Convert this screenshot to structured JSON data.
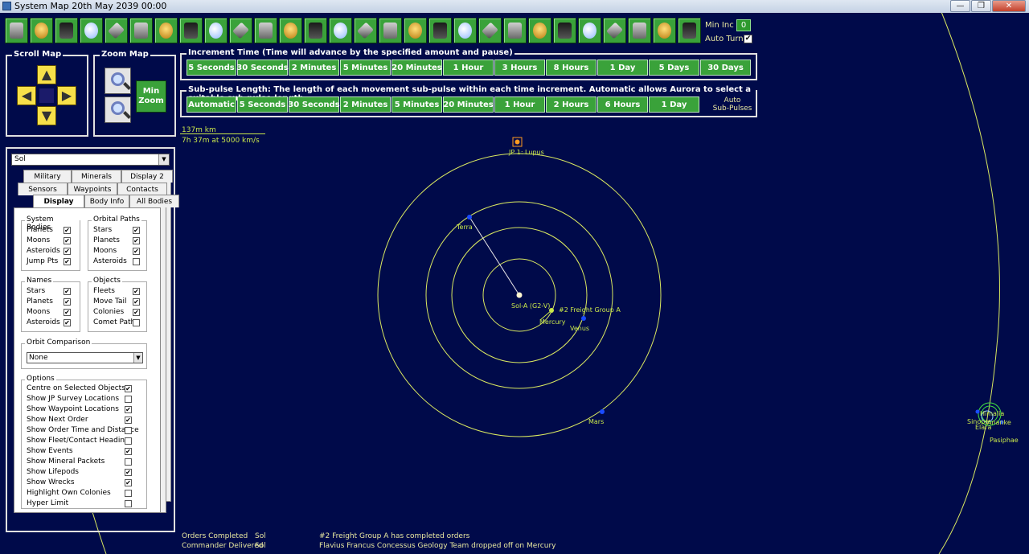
{
  "window": {
    "title": "System Map   20th May 2039 00:00"
  },
  "toolbar": {
    "buttons": [
      "economics-icon",
      "industry-icon",
      "research-icon",
      "wealth-icon",
      "ground-forces-icon",
      "commander-icon",
      "class-design-icon",
      "fleet-icon",
      "missile-icon",
      "ship-icon",
      "hostile-icon",
      "waypoint-icon",
      "star-icon",
      "galactic-map-icon",
      "alien-icon",
      "ruins-icon",
      "survey-icon",
      "minerals-icon",
      "wrench-icon",
      "shipyard-icon",
      "project-icon",
      "sensor-icon",
      "intelligence-icon",
      "turn-icon",
      "tech-icon",
      "refresh-icon",
      "race-icon",
      "medal-icon"
    ],
    "min_inc_label": "Min Inc",
    "min_inc_value": "0",
    "auto_turns_label": "Auto Turns"
  },
  "scroll_map": {
    "title": "Scroll Map"
  },
  "zoom_map": {
    "title": "Zoom Map",
    "min_zoom_label": "Min\nZoom"
  },
  "increment": {
    "title": "Increment Time (Time will advance by the specified amount and pause)",
    "buttons": [
      "5 Seconds",
      "30 Seconds",
      "2 Minutes",
      "5 Minutes",
      "20 Minutes",
      "1 Hour",
      "3 Hours",
      "8 Hours",
      "1 Day",
      "5 Days",
      "30 Days"
    ]
  },
  "subpulse": {
    "title": "Sub-pulse Length: The length of each movement sub-pulse within each time increment. Automatic allows Aurora to select a suitable sub-pulse length",
    "buttons": [
      "Automatic",
      "5 Seconds",
      "30 Seconds",
      "2 Minutes",
      "5 Minutes",
      "20 Minutes",
      "1 Hour",
      "2 Hours",
      "6 Hours",
      "1 Day"
    ],
    "auto_label": "Auto\nSub-Pulses"
  },
  "scale": {
    "distance": "137m km",
    "travel": "7h 37m at 5000 km/s"
  },
  "side": {
    "system": "Sol",
    "tabs_row1": [
      "Military",
      "Minerals",
      "Display 2"
    ],
    "tabs_row2": [
      "Sensors",
      "Waypoints",
      "Contacts"
    ],
    "tabs_row3": [
      "Display",
      "Body Info",
      "All Bodies"
    ],
    "system_bodies": {
      "title": "System Bodies",
      "items": [
        "Planets",
        "Moons",
        "Asteroids",
        "Jump Pts"
      ],
      "checked": [
        true,
        true,
        true,
        true
      ]
    },
    "orbital_paths": {
      "title": "Orbital Paths",
      "items": [
        "Stars",
        "Planets",
        "Moons",
        "Asteroids"
      ],
      "checked": [
        true,
        true,
        true,
        false
      ]
    },
    "names": {
      "title": "Names",
      "items": [
        "Stars",
        "Planets",
        "Moons",
        "Asteroids"
      ],
      "checked": [
        true,
        true,
        true,
        true
      ]
    },
    "objects": {
      "title": "Objects",
      "items": [
        "Fleets",
        "Move Tail",
        "Colonies",
        "Comet Path"
      ],
      "checked": [
        true,
        true,
        true,
        false
      ]
    },
    "orbit_comparison": {
      "title": "Orbit Comparison",
      "value": "None"
    },
    "options": {
      "title": "Options",
      "items": [
        "Centre on Selected Objects",
        "Show JP Survey Locations",
        "Show Waypoint Locations",
        "Show Next Order",
        "Show Order Time and Distance",
        "Show Fleet/Contact Heading",
        "Show Events",
        "Show Mineral Packets",
        "Show Lifepods",
        "Show Wrecks",
        "Highlight Own Colonies",
        "Hyper Limit"
      ],
      "checked": [
        true,
        false,
        true,
        true,
        false,
        false,
        true,
        false,
        true,
        true,
        false,
        false
      ]
    }
  },
  "map": {
    "star": "Sol-A (G2-V)",
    "jump_point": "JP 1: Lupus",
    "fleet": "#2 Freight Group A",
    "planets": [
      "Mercury",
      "Venus",
      "Terra",
      "Mars"
    ],
    "cluster_labels": [
      "Sinope",
      "Himalia",
      "Ananke",
      "Elara",
      "Pasiphae"
    ]
  },
  "events": [
    {
      "type": "Orders Completed",
      "system": "Sol",
      "text": "#2 Freight Group A has completed orders"
    },
    {
      "type": "Commander Delivered",
      "system": "Sol",
      "text": "Flavius Francus Concessus Geology Team dropped off on Mercury"
    }
  ]
}
